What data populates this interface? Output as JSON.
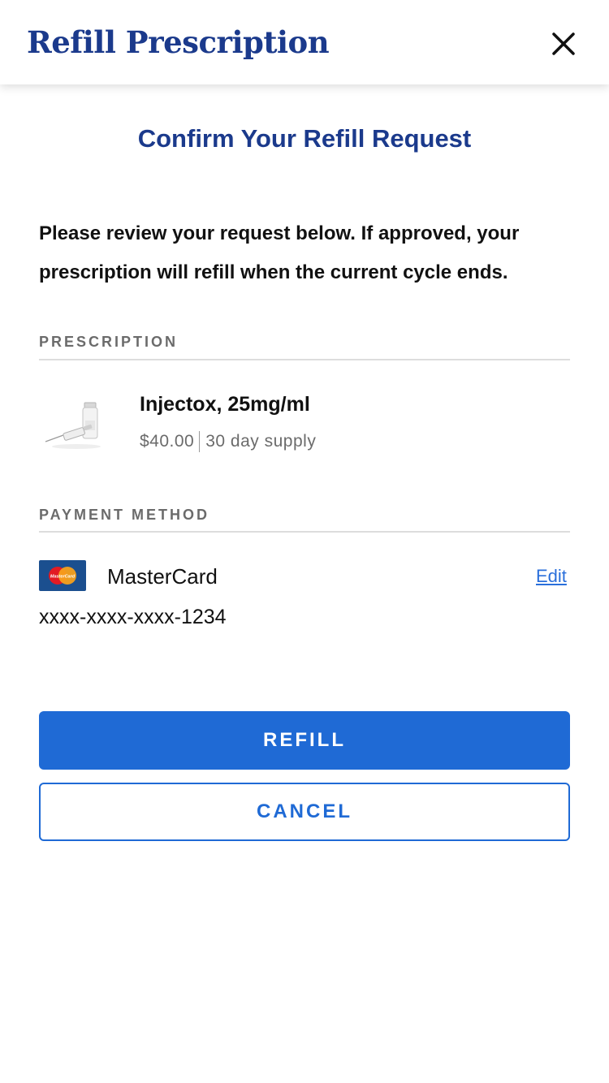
{
  "header": {
    "title": "Refill Prescription",
    "close_icon": "close-icon"
  },
  "confirm": {
    "title": "Confirm Your Refill Request",
    "intro": "Please review your request below. If approved, your prescription will refill when the current cycle ends."
  },
  "prescription": {
    "section_label": "PRESCRIPTION",
    "image_icon": "syringe-vial-image",
    "name": "Injectox, 25mg/ml",
    "price": "$40.00",
    "supply": "30 day supply"
  },
  "payment": {
    "section_label": "PAYMENT METHOD",
    "card_icon": "mastercard-logo",
    "card_logo_text": "MasterCard",
    "card_name": "MasterCard",
    "edit_label": "Edit",
    "card_number": "xxxx-xxxx-xxxx-1234"
  },
  "actions": {
    "refill_label": "REFILL",
    "cancel_label": "CANCEL"
  },
  "colors": {
    "brand_navy": "#1b3a8c",
    "primary_blue": "#1f6ad5",
    "link_blue": "#2a6fdb",
    "label_gray": "#6b6b6b"
  }
}
